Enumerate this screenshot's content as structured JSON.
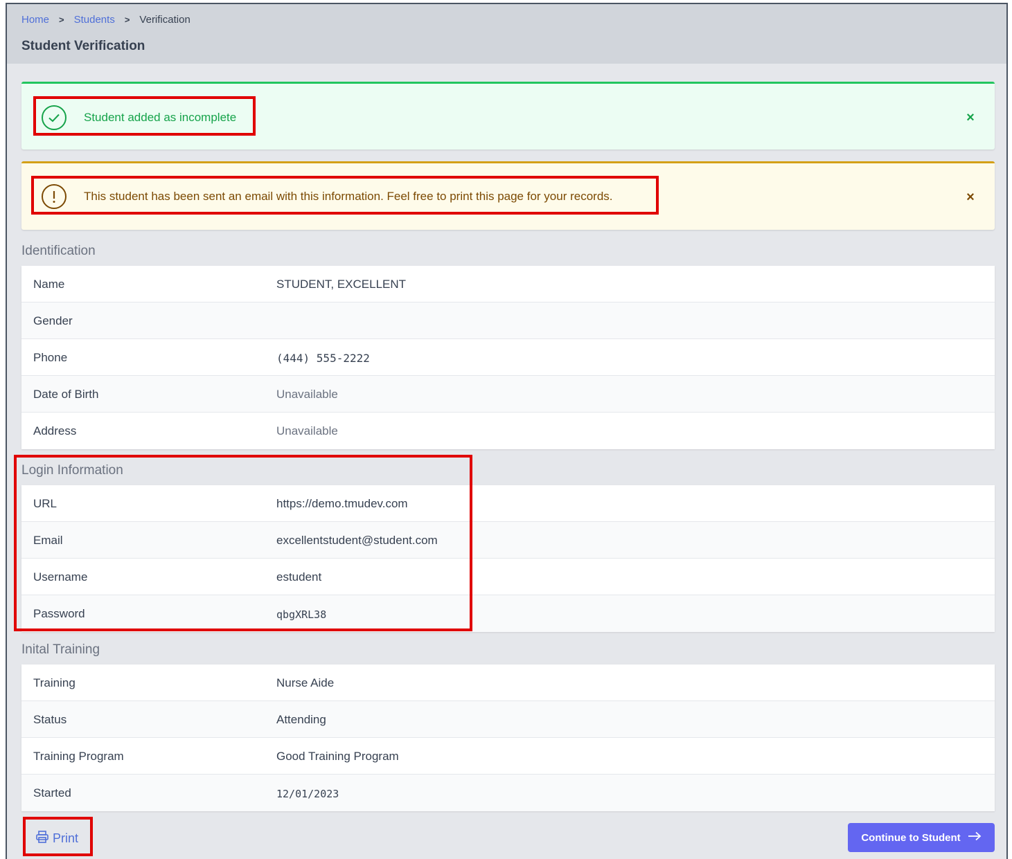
{
  "breadcrumb": {
    "items": [
      "Home",
      "Students"
    ],
    "current": "Verification",
    "separator": ">"
  },
  "page_title": "Student Verification",
  "alerts": {
    "success": {
      "message": "Student added as incomplete",
      "icon": "check-circle-icon",
      "color": "#16a34a"
    },
    "warning": {
      "message": "This student has been sent an email with this information. Feel free to print this page for your records.",
      "icon": "exclamation-circle-icon",
      "color": "#7c4a03"
    },
    "close_glyph": "×"
  },
  "identification": {
    "title": "Identification",
    "rows": [
      {
        "label": "Name",
        "value": "STUDENT, EXCELLENT"
      },
      {
        "label": "Gender",
        "value": ""
      },
      {
        "label": "Phone",
        "value": "(444) 555-2222"
      },
      {
        "label": "Date of Birth",
        "value": "Unavailable"
      },
      {
        "label": "Address",
        "value": "Unavailable"
      }
    ]
  },
  "login": {
    "title": "Login Information",
    "rows": [
      {
        "label": "URL",
        "value": "https://demo.tmudev.com"
      },
      {
        "label": "Email",
        "value": "excellentstudent@student.com"
      },
      {
        "label": "Username",
        "value": "estudent"
      },
      {
        "label": "Password",
        "value": "qbgXRL38"
      }
    ]
  },
  "training": {
    "title": "Inital Training",
    "rows": [
      {
        "label": "Training",
        "value": "Nurse Aide"
      },
      {
        "label": "Status",
        "value": "Attending"
      },
      {
        "label": "Training Program",
        "value": "Good Training Program"
      },
      {
        "label": "Started",
        "value": "12/01/2023"
      }
    ]
  },
  "actions": {
    "print_label": "Print",
    "print_icon": "printer-icon",
    "continue_label": "Continue to Student",
    "continue_icon": "arrow-right-icon",
    "continue_color": "#6366f1"
  }
}
